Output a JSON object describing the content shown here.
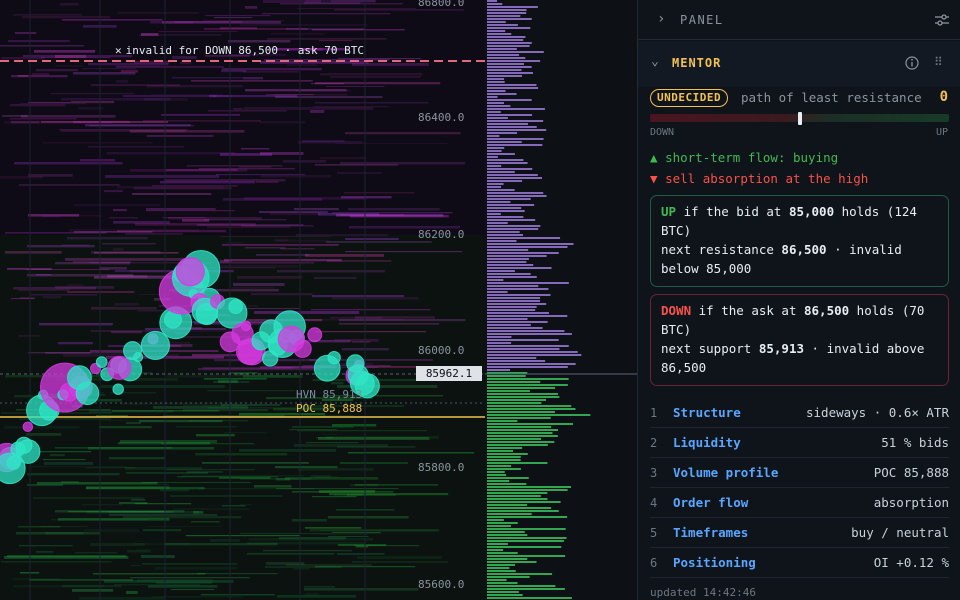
{
  "chart": {
    "price_axis": [
      "86800.0",
      "86400.0",
      "86200.0",
      "86000.0",
      "85800.0",
      "85600.0"
    ],
    "current_price": "85962.1",
    "invalid_note": "invalid for DOWN 86,500 · ask 70 BTC",
    "hvn_label": "HVN 85,913",
    "poc_label": "POC 85,888",
    "colors": {
      "bubble": "#2ee6c5",
      "bubble_alt": "#d63ae0",
      "poc": "#f2c14e",
      "invalid": "#e06a7c"
    }
  },
  "panel": {
    "header": {
      "title": "PANEL",
      "collapse_icon": "chevron-right-icon",
      "settings_icon": "sliders-icon"
    },
    "mentor": {
      "title": "MENTOR",
      "badge": "UNDECIDED",
      "badge_note": "path of least resistance",
      "score": "0",
      "bar_value": 0.5,
      "down_label": "DOWN",
      "up_label": "UP",
      "signal_buy": "short-term flow: buying",
      "signal_sell": "sell absorption at the high",
      "up_card": {
        "kw": "UP",
        "t1": " if the bid at ",
        "b1": "85,000",
        "t2": " holds (124 BTC)",
        "t3": "next resistance ",
        "b2": "86,500",
        "t4": " · invalid below 85,000"
      },
      "down_card": {
        "kw": "DOWN",
        "t1": " if the ask at ",
        "b1": "86,500",
        "t2": " holds (70 BTC)",
        "t3": "next support ",
        "b2": "85,913",
        "t4": " · invalid above 86,500"
      },
      "factors": [
        {
          "n": "1",
          "k": "Structure",
          "v": "sideways · 0.6× ATR"
        },
        {
          "n": "2",
          "k": "Liquidity",
          "v": "51 % bids"
        },
        {
          "n": "3",
          "k": "Volume profile",
          "v": "POC 85,888"
        },
        {
          "n": "4",
          "k": "Order flow",
          "v": "absorption"
        },
        {
          "n": "5",
          "k": "Timeframes",
          "v": "buy / neutral"
        },
        {
          "n": "6",
          "k": "Positioning",
          "v": "OI +0.12 %"
        }
      ],
      "updated": "updated 14:42:46"
    }
  }
}
